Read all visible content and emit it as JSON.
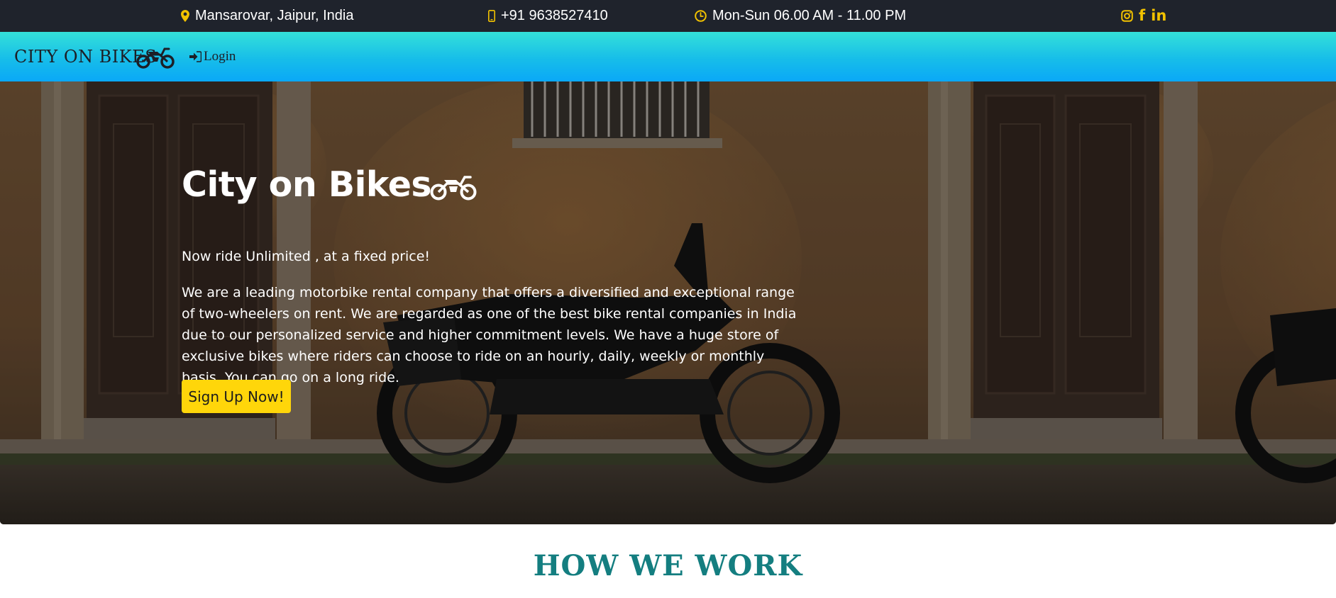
{
  "topbar": {
    "location": {
      "icon": "map-marker-icon",
      "text": "Mansarovar, Jaipur, India"
    },
    "phone": {
      "icon": "mobile-phone-icon",
      "text": "+91 9638527410"
    },
    "hours": {
      "icon": "clock-icon",
      "text": "Mon-Sun 06.00 AM - 11.00 PM"
    },
    "social": [
      {
        "icon": "instagram-icon"
      },
      {
        "icon": "facebook-icon",
        "glyph": "f"
      },
      {
        "icon": "linkedin-icon",
        "glyph": "in"
      }
    ],
    "icon_color": "#f2c200",
    "background": "#1f232c"
  },
  "navbar": {
    "brand": "CITY ON BIKES",
    "brand_icon": "motorcycle-icon",
    "login_label": "Login",
    "login_icon": "sign-in-icon",
    "gradient": [
      "#34e1d9",
      "#0aa8f7"
    ]
  },
  "hero": {
    "title": "City on Bikes",
    "title_icon": "motorcycle-icon",
    "tagline": "Now ride Unlimited , at a fixed price!",
    "description": "We are a leading motorbike rental company that offers a diversified and exceptional range of two-wheelers on rent. We are regarded as one of the best bike rental companies in India due to our personalized service and higher commitment levels. We have a huge store of exclusive bikes where riders can choose to ride on an hourly, daily, weekly or monthly basis. You can go on a long ride.",
    "cta_label": "Sign Up Now!",
    "cta_color": "#ffd60a"
  },
  "section": {
    "heading": "HOW WE WORK",
    "heading_color": "#147e80"
  }
}
